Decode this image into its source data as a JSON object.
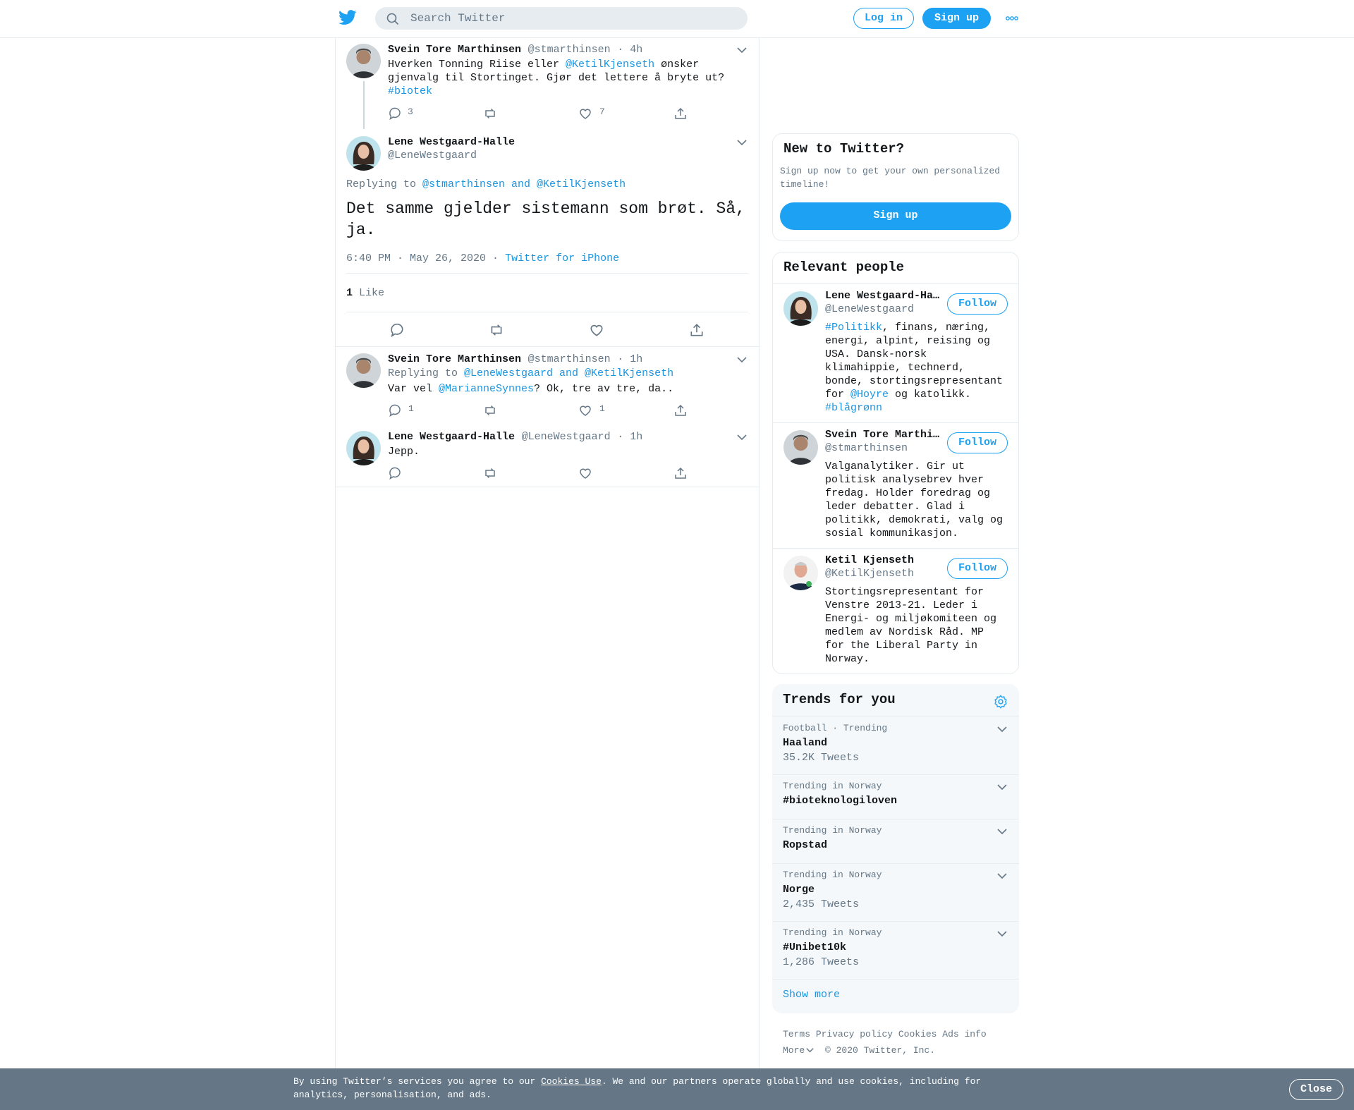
{
  "header": {
    "search_placeholder": "Search Twitter",
    "login_label": "Log in",
    "signup_label": "Sign up"
  },
  "thread": {
    "tweet1": {
      "name": "Svein Tore Marthinsen",
      "handle": "@stmarthinsen",
      "time": "· 4h",
      "text_part1": "Hverken Tonning Riise eller ",
      "mention": "@KetilKjenseth",
      "text_part2": " ønsker gjenvalg til Stortinget. Gjør det lettere å bryte ut?",
      "hashtag": "#biotek",
      "replies": "3",
      "likes": "7"
    },
    "main": {
      "name": "Lene Westgaard-Halle",
      "handle": "@LeneWestgaard",
      "replying_label": "Replying to ",
      "replying_to": "@stmarthinsen and @KetilKjenseth",
      "text": "Det samme gjelder sistemann som brøt. Så, ja.",
      "timestamp": "6:40 PM · May 26, 2020 ·",
      "source": "Twitter for iPhone",
      "like_count": "1",
      "like_label": "Like"
    },
    "reply1": {
      "name": "Svein Tore Marthinsen",
      "handle": "@stmarthinsen",
      "time": "· 1h",
      "replying_label": "Replying to ",
      "replying_to": "@LeneWestgaard and @KetilKjenseth",
      "text_part1": "Var vel ",
      "mention": "@MarianneSynnes",
      "text_part2": "? Ok, tre av tre, da..",
      "replies": "1",
      "likes": "1"
    },
    "reply2": {
      "name": "Lene Westgaard-Halle",
      "handle": "@LeneWestgaard",
      "time": "· 1h",
      "text": "Jepp."
    }
  },
  "new_to_twitter": {
    "title": "New to Twitter?",
    "subtitle": "Sign up now to get your own personalized timeline!",
    "button": "Sign up"
  },
  "relevant_people": {
    "title": "Relevant people",
    "follow_label": "Follow",
    "people": [
      {
        "name": "Lene Westgaard-Ha…",
        "handle": "@LeneWestgaard",
        "bio_tag1": "#Politikk",
        "bio_text1": ", finans, næring, energi, alpint, reising og USA. Dansk-norsk klimahippie, technerd, bonde, stortingsrepresentant for ",
        "bio_mention": "@Hoyre",
        "bio_text2": " og katolikk. ",
        "bio_tag2": "#blågrønn"
      },
      {
        "name": "Svein Tore Marthi…",
        "handle": "@stmarthinsen",
        "bio": "Valganalytiker. Gir ut politisk analysebrev hver fredag. Holder foredrag og leder debatter. Glad i politikk, demokrati, valg og sosial kommunikasjon."
      },
      {
        "name": "Ketil Kjenseth",
        "handle": "@KetilKjenseth",
        "bio": "Stortingsrepresentant for Venstre 2013-21. Leder i Energi- og miljøkomiteen og medlem av Nordisk Råd. MP for the Liberal Party in Norway."
      }
    ]
  },
  "trends": {
    "title": "Trends for you",
    "items": [
      {
        "context": "Football · Trending",
        "name": "Haaland",
        "count": "35.2K Tweets"
      },
      {
        "context": "Trending in Norway",
        "name": "#bioteknologiloven",
        "count": ""
      },
      {
        "context": "Trending in Norway",
        "name": "Ropstad",
        "count": ""
      },
      {
        "context": "Trending in Norway",
        "name": "Norge",
        "count": "2,435 Tweets"
      },
      {
        "context": "Trending in Norway",
        "name": "#Unibet10k",
        "count": "1,286 Tweets"
      }
    ],
    "show_more": "Show more"
  },
  "footer": {
    "links": [
      "Terms",
      "Privacy policy",
      "Cookies",
      "Ads info"
    ],
    "more": "More",
    "copyright": "© 2020 Twitter, Inc."
  },
  "cookie_bar": {
    "text_before": "By using Twitter’s services you agree to our ",
    "link": "Cookies Use",
    "text_after": ". We and our partners operate globally and use cookies, including for analytics, personalisation, and ads.",
    "close": "Close"
  },
  "colors": {
    "accent": "#1da1f2",
    "link": "#1b95e0",
    "muted": "#657786",
    "cookie_bar": "#657786"
  }
}
